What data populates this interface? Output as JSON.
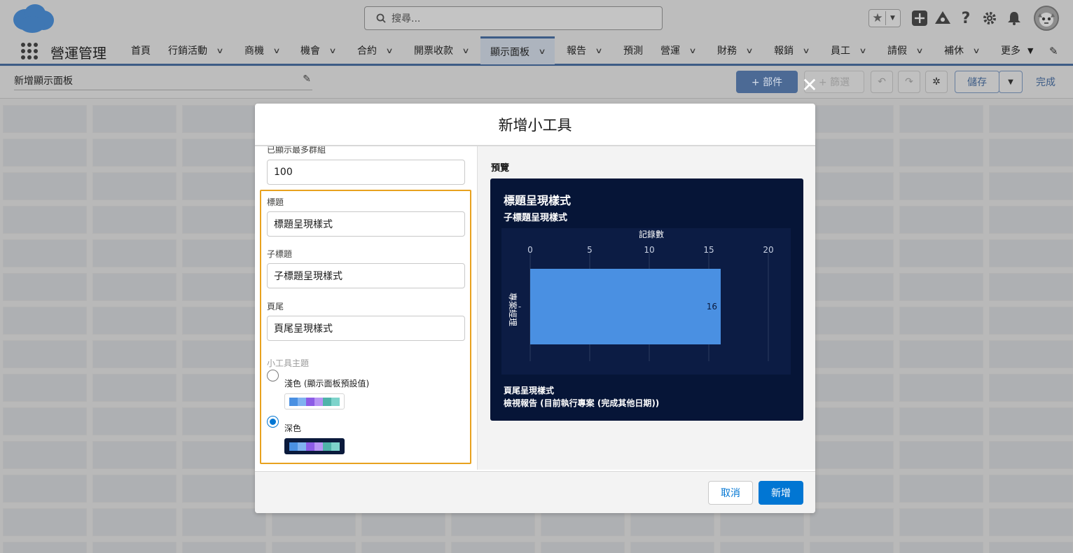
{
  "header": {
    "search_placeholder": "搜尋...",
    "app_name": "營運管理"
  },
  "nav": {
    "items": [
      {
        "label": "首頁",
        "dropdown": false
      },
      {
        "label": "行銷活動",
        "dropdown": true
      },
      {
        "label": "商機",
        "dropdown": true
      },
      {
        "label": "機會",
        "dropdown": true
      },
      {
        "label": "合約",
        "dropdown": true
      },
      {
        "label": "開票收款",
        "dropdown": true
      },
      {
        "label": "顯示面板",
        "dropdown": true,
        "active": true
      },
      {
        "label": "報告",
        "dropdown": true
      },
      {
        "label": "預測",
        "dropdown": false
      },
      {
        "label": "營運",
        "dropdown": true
      },
      {
        "label": "財務",
        "dropdown": true
      },
      {
        "label": "報銷",
        "dropdown": true
      },
      {
        "label": "員工",
        "dropdown": true
      },
      {
        "label": "請假",
        "dropdown": true
      },
      {
        "label": "補休",
        "dropdown": true
      },
      {
        "label": "更多",
        "dropdown": true
      }
    ]
  },
  "builder": {
    "dashboard_name": "新增顯示面板",
    "add_widget": "+ 部件",
    "filter": "+ 篩選",
    "save": "儲存",
    "done": "完成"
  },
  "modal": {
    "title": "新增小工具",
    "max_groups_label": "已顯示最多群組",
    "max_groups_value": "100",
    "title_label": "標題",
    "title_value": "標題呈現樣式",
    "subtitle_label": "子標題",
    "subtitle_value": "子標題呈現樣式",
    "footer_label": "頁尾",
    "footer_value": "頁尾呈現樣式",
    "theme_label": "小工具主題",
    "theme_light": "淺色 (顯示面板預設值)",
    "theme_dark": "深色",
    "selected_theme": "深色",
    "preview_label": "預覽",
    "cancel": "取消",
    "add": "新增"
  },
  "theme_swatch_colors": [
    "#4a90e2",
    "#7fb2f0",
    "#8c5ce6",
    "#b794f4",
    "#4fb3a9",
    "#7dd3cb"
  ],
  "preview": {
    "title": "標題呈現樣式",
    "subtitle": "子標題呈現樣式",
    "footer": "頁尾呈現樣式",
    "report_link": "檢視報告 (目前執行專案 (完成其他日期))",
    "colors": {
      "background": "#061537",
      "bar": "#4a90e2"
    }
  },
  "chart_data": {
    "type": "bar",
    "orientation": "horizontal",
    "xlabel": "記錄數",
    "ylabel": "專案經理",
    "categories": [
      "-"
    ],
    "values": [
      16
    ],
    "xlim": [
      0,
      20
    ],
    "xticks": [
      0,
      5,
      10,
      15,
      20
    ],
    "data_labels": [
      "16"
    ],
    "x_axis_position": "top",
    "grid": true
  }
}
